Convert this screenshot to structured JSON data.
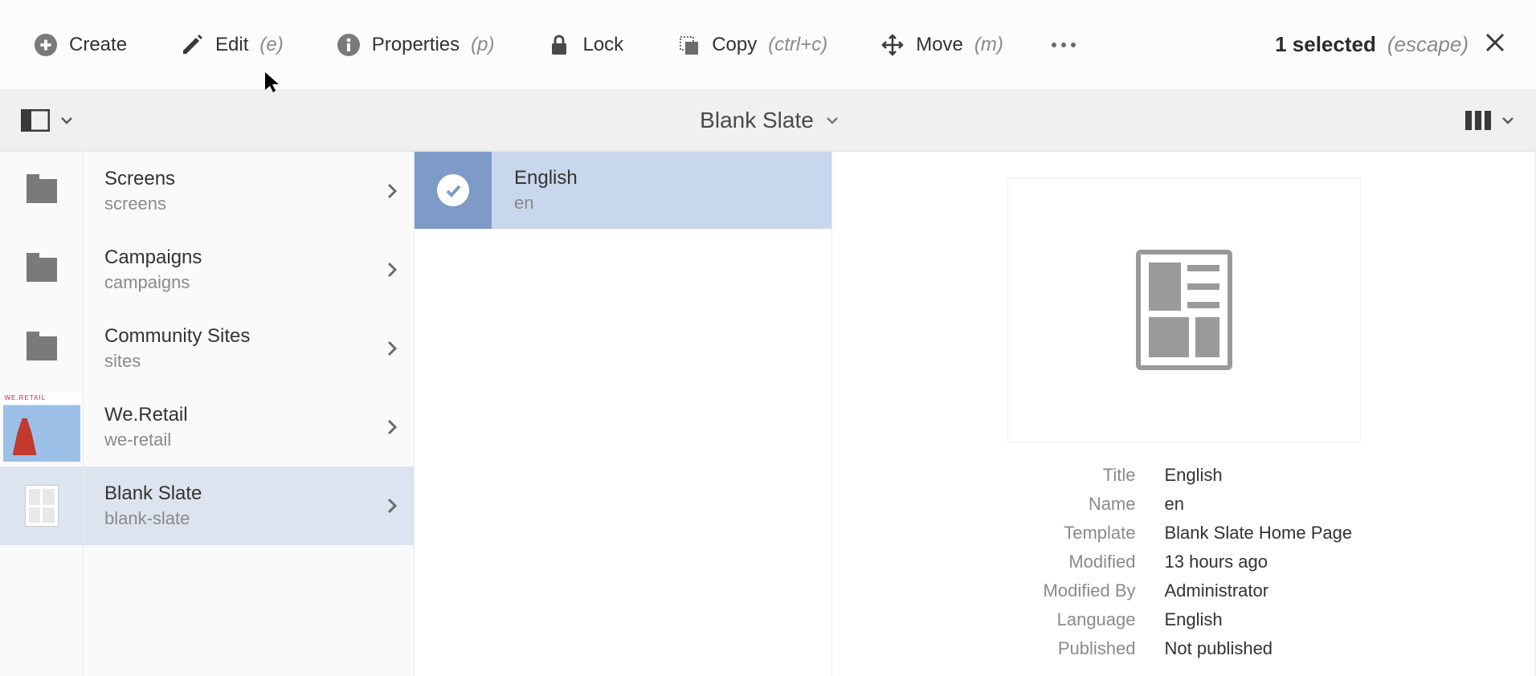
{
  "toolbar": {
    "create": "Create",
    "edit": "Edit",
    "edit_shortcut": "(e)",
    "properties": "Properties",
    "properties_shortcut": "(p)",
    "lock": "Lock",
    "copy": "Copy",
    "copy_shortcut": "(ctrl+c)",
    "move": "Move",
    "move_shortcut": "(m)",
    "selection_count": "1 selected",
    "selection_escape": "(escape)"
  },
  "secbar": {
    "title": "Blank Slate"
  },
  "nav": {
    "items": [
      {
        "title": "Screens",
        "name": "screens",
        "icon": "folder"
      },
      {
        "title": "Campaigns",
        "name": "campaigns",
        "icon": "folder"
      },
      {
        "title": "Community Sites",
        "name": "sites",
        "icon": "folder"
      },
      {
        "title": "We.Retail",
        "name": "we-retail",
        "icon": "weretail"
      },
      {
        "title": "Blank Slate",
        "name": "blank-slate",
        "icon": "page"
      }
    ]
  },
  "selection": {
    "title": "English",
    "name": "en"
  },
  "detail": {
    "fields": {
      "Title": "English",
      "Name": "en",
      "Template": "Blank Slate Home Page",
      "Modified": "13 hours ago",
      "Modified By": "Administrator",
      "Language": "English",
      "Published": "Not published"
    },
    "labels": {
      "title": "Title",
      "name": "Name",
      "template": "Template",
      "modified": "Modified",
      "modified_by": "Modified By",
      "language": "Language",
      "published": "Published"
    }
  },
  "weretail_label": "WE.RETAIL"
}
